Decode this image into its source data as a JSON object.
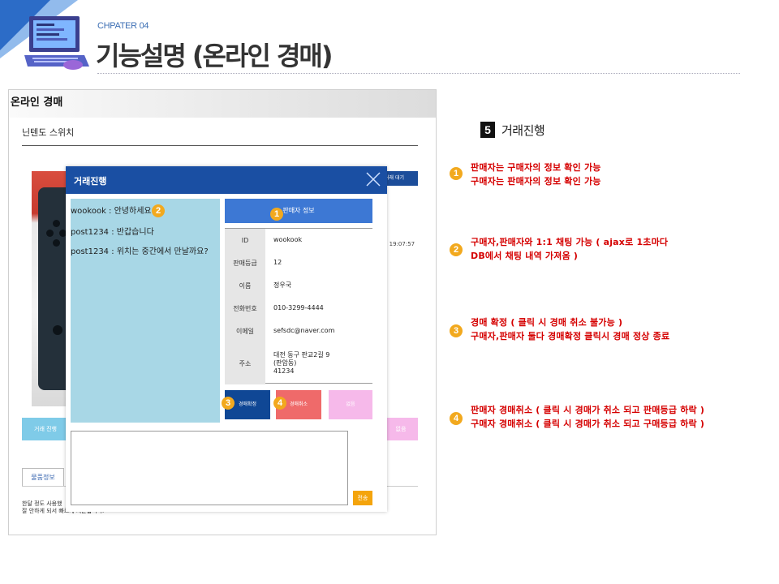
{
  "header": {
    "chapter": "CHPATER 04",
    "title": "기능설명 (온라인 경매)"
  },
  "page": {
    "title": "온라인 경매",
    "product_name": "닌텐도 스위치",
    "bg_tab_right": "거래 대기",
    "bg_date": "-07 19:07:57",
    "bg_button_left": "거래 진행",
    "bg_button_right": "없음",
    "info_tab": "물품정보",
    "desc_line1": "한달 정도 사용했",
    "desc_line2": "잘 안하게 되서 빠르게 처분합니다."
  },
  "modal": {
    "title": "거래진행",
    "chat": [
      "wookook : 안녕하세요",
      "post1234 : 반갑습니다",
      "post1234 : 위치는 중간에서 만날까요?"
    ],
    "seller_info_label": "판매자 정보",
    "info_rows": [
      {
        "key": "ID",
        "value": "wookook"
      },
      {
        "key": "판매등급",
        "value": "12"
      },
      {
        "key": "이름",
        "value": "정우국"
      },
      {
        "key": "전화번호",
        "value": "010-3299-4444"
      },
      {
        "key": "이메일",
        "value": "sefsdc@naver.com"
      },
      {
        "key": "주소",
        "value": "대전 동구 판교2길 9\n(판암동)\n41234"
      }
    ],
    "confirm_button": "경매확정",
    "cancel_button": "경매취소",
    "other_button": "없음",
    "send_button": "전송"
  },
  "markers": [
    "1",
    "2",
    "3",
    "4"
  ],
  "step": {
    "number": "5",
    "title": "거래진행"
  },
  "notes": [
    {
      "marker": "1",
      "lines": [
        "판매자는 구매자의 정보 확인 가능",
        "구매자는 판매자의 정보 확인 가능"
      ]
    },
    {
      "marker": "2",
      "lines": [
        "구매자,판매자와 1:1 채팅 가능 ( ajax로 1초마다",
        "DB에서 채팅 내역 가져옴 )"
      ]
    },
    {
      "marker": "3",
      "lines": [
        "경매 확정 ( 클릭 시 경매 취소 불가능 )",
        "구매자,판매자 둘다 경매확정 클릭시 경매 정상 종료"
      ]
    },
    {
      "marker": "4",
      "lines": [
        "판매자 경매취소 ( 클릭 시 경매가 취소 되고 판매등급 하락 )",
        "구매자 경매취소 ( 클릭 시 경매가 취소 되고 구매등급 하락 )"
      ]
    }
  ],
  "colors": {
    "modal_header": "#1a4fa3",
    "chat_bg": "#a8d7e6",
    "confirm": "#0f4795",
    "cancel": "#ef6a6a",
    "marker": "#f2a91e",
    "note_text": "#d50000"
  }
}
